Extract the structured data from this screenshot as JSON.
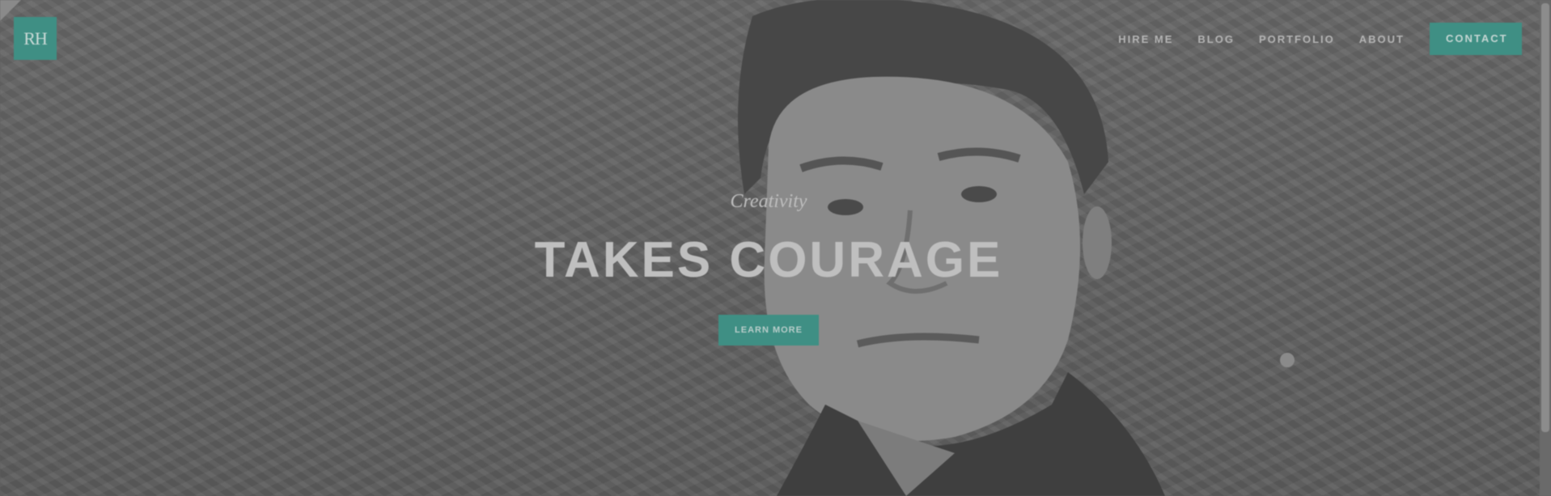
{
  "logo": {
    "text": "RH"
  },
  "nav": {
    "items": [
      {
        "label": "HIRE ME"
      },
      {
        "label": "BLOG"
      },
      {
        "label": "PORTFOLIO"
      },
      {
        "label": "ABOUT"
      }
    ],
    "contact_label": "CONTACT"
  },
  "hero": {
    "tagline": "Creativity",
    "headline": "TAKES COURAGE",
    "button_label": "LEARN MORE"
  },
  "colors": {
    "accent": "#3f8f84",
    "overlay": "#5f5f5f"
  },
  "icons": {
    "carousel_dot": "circle-dot"
  }
}
